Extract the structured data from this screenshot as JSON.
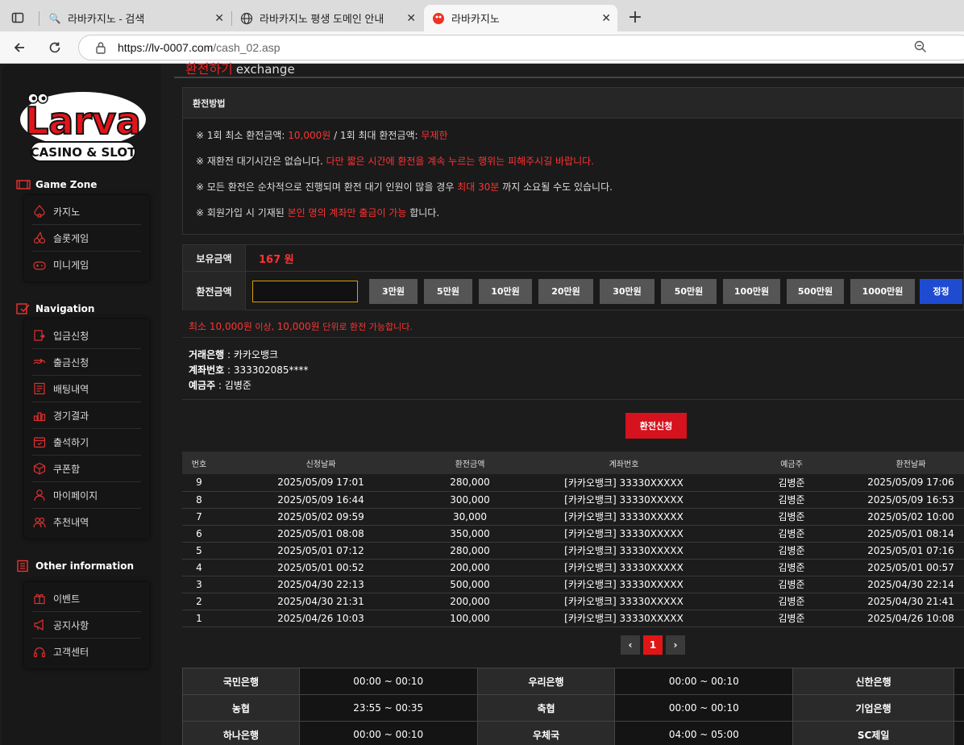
{
  "browser": {
    "tabs": [
      {
        "title": "라바카지노 - 검색",
        "favicon": "search-icon"
      },
      {
        "title": "라바카지노 평생 도메인 안내",
        "favicon": "globe-icon"
      },
      {
        "title": "라바카지노",
        "favicon": "larva-icon",
        "active": true
      }
    ],
    "url_host": "https://lv-0007.com",
    "url_path": "/cash_02.asp"
  },
  "sidebar": {
    "logo_text_top": "Larva",
    "logo_text_bottom": "CASINO & SLOT",
    "sections": [
      {
        "title": "Game Zone",
        "items": [
          "카지노",
          "슬롯게임",
          "미니게임"
        ]
      },
      {
        "title": "Navigation",
        "items": [
          "입금신청",
          "출금신청",
          "배팅내역",
          "경기결과",
          "출석하기",
          "쿠폰함",
          "마이페이지",
          "추천내역"
        ]
      },
      {
        "title": "Other information",
        "items": [
          "이벤트",
          "공지사항",
          "고객센터"
        ]
      }
    ]
  },
  "header": {
    "title_ko": "환전하기",
    "title_en": "exchange"
  },
  "method": {
    "title": "환전방법",
    "line1": {
      "a": "※ 1회 최소 환전금액: ",
      "b": "10,000원",
      "c": " / 1회 최대 환전금액: ",
      "d": "무제한"
    },
    "line2": {
      "a": "※ 재환전 대기시간은 없습니다. ",
      "b": "다만 짧은 시간에 환전을 계속 누르는 행위는 피해주시길 바랍니다."
    },
    "line3": {
      "a": "※ 모든 환전은 순차적으로 진행되며 환전 대기 인원이 많을 경우 ",
      "b": "최대 30분",
      "c": " 까지 소요될 수도 있습니다."
    },
    "line4": {
      "a": "※ 회원가입 시 기재된 ",
      "b": "본인 명의 계좌만 출금이 가능",
      "c": " 합니다."
    }
  },
  "form": {
    "balance_label": "보유금액",
    "balance_value": "167 원",
    "amount_label": "환전금액",
    "amount_value": "",
    "quick_buttons": [
      "3만원",
      "5만원",
      "10만원",
      "20만원",
      "30만원",
      "50만원",
      "100만원",
      "500만원",
      "1000만원"
    ],
    "correct_button": "정정",
    "notice_a": "최소 10,000원",
    "notice_b": " 이상, ",
    "notice_c": "10,000원",
    "notice_d": "  단위로 환전 가능합니다."
  },
  "bank": {
    "bank_label": "거래은행",
    "bank_value": " : 카카오뱅크",
    "account_label": "계좌번호",
    "account_value": " : 333302085****",
    "holder_label": "예금주",
    "holder_value": " : 김병준"
  },
  "submit_label": "환전신청",
  "history": {
    "headers": [
      "번호",
      "신청날짜",
      "환전금액",
      "계좌번호",
      "예금주",
      "환전날짜"
    ],
    "rows": [
      [
        "9",
        "2025/05/09 17:01",
        "280,000",
        "[카카오뱅크] 33330XXXXX",
        "김병준",
        "2025/05/09 17:06"
      ],
      [
        "8",
        "2025/05/09 16:44",
        "300,000",
        "[카카오뱅크] 33330XXXXX",
        "김병준",
        "2025/05/09 16:53"
      ],
      [
        "7",
        "2025/05/02 09:59",
        "30,000",
        "[카카오뱅크] 33330XXXXX",
        "김병준",
        "2025/05/02 10:00"
      ],
      [
        "6",
        "2025/05/01 08:08",
        "350,000",
        "[카카오뱅크] 33330XXXXX",
        "김병준",
        "2025/05/01 08:14"
      ],
      [
        "5",
        "2025/05/01 07:12",
        "280,000",
        "[카카오뱅크] 33330XXXXX",
        "김병준",
        "2025/05/01 07:16"
      ],
      [
        "4",
        "2025/05/01 00:52",
        "200,000",
        "[카카오뱅크] 33330XXXXX",
        "김병준",
        "2025/05/01 00:57"
      ],
      [
        "3",
        "2025/04/30 22:13",
        "500,000",
        "[카카오뱅크] 33330XXXXX",
        "김병준",
        "2025/04/30 22:14"
      ],
      [
        "2",
        "2025/04/30 21:31",
        "200,000",
        "[카카오뱅크] 33330XXXXX",
        "김병준",
        "2025/04/30 21:41"
      ],
      [
        "1",
        "2025/04/26 10:03",
        "100,000",
        "[카카오뱅크] 33330XXXXX",
        "김병준",
        "2025/04/26 10:08"
      ]
    ]
  },
  "pagination": {
    "prev": "‹",
    "current": "1",
    "next": "›"
  },
  "bank_hours": [
    [
      "국민은행",
      "00:00 ~ 00:10",
      "우리은행",
      "00:00 ~ 00:10",
      "신한은행",
      ""
    ],
    [
      "농협",
      "23:55 ~ 00:35",
      "축협",
      "00:00 ~ 00:10",
      "기업은행",
      ""
    ],
    [
      "하나은행",
      "00:00 ~ 00:10",
      "우체국",
      "04:00 ~ 05:00",
      "SC제일",
      ""
    ]
  ],
  "colors": {
    "accent": "#e01616",
    "blue": "#1f4bd1"
  }
}
